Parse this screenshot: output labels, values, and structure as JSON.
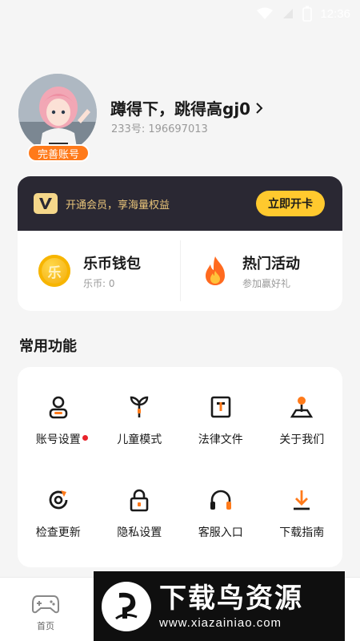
{
  "status_bar": {
    "time": "12:36"
  },
  "profile": {
    "name": "蹲得下，跳得高gj0",
    "id_text": "233号: 196697013",
    "complete_badge": "完善账号"
  },
  "vip": {
    "text": "开通会员，享海量权益",
    "button": "立即开卡"
  },
  "quick": [
    {
      "title": "乐币钱包",
      "sub": "乐币: 0",
      "icon": "coin-icon",
      "glyph": "乐"
    },
    {
      "title": "热门活动",
      "sub": "参加赢好礼",
      "icon": "fire-icon"
    }
  ],
  "functions": {
    "title": "常用功能",
    "items": [
      {
        "label": "账号设置",
        "icon": "account-icon",
        "dot": true
      },
      {
        "label": "儿童模式",
        "icon": "sprout-icon"
      },
      {
        "label": "法律文件",
        "icon": "legal-doc-icon"
      },
      {
        "label": "关于我们",
        "icon": "joystick-icon"
      },
      {
        "label": "检查更新",
        "icon": "refresh-icon"
      },
      {
        "label": "隐私设置",
        "icon": "lock-icon"
      },
      {
        "label": "客服入口",
        "icon": "headset-icon"
      },
      {
        "label": "下载指南",
        "icon": "download-icon"
      }
    ]
  },
  "bottom_nav": {
    "home": "首页"
  },
  "watermark": {
    "title": "下载鸟资源",
    "url": "www.xiazainiao.com"
  },
  "colors": {
    "accent": "#ff7a1a",
    "vip_bg": "#2a2833",
    "vip_btn": "#ffc92e",
    "dot": "#e8232b"
  }
}
